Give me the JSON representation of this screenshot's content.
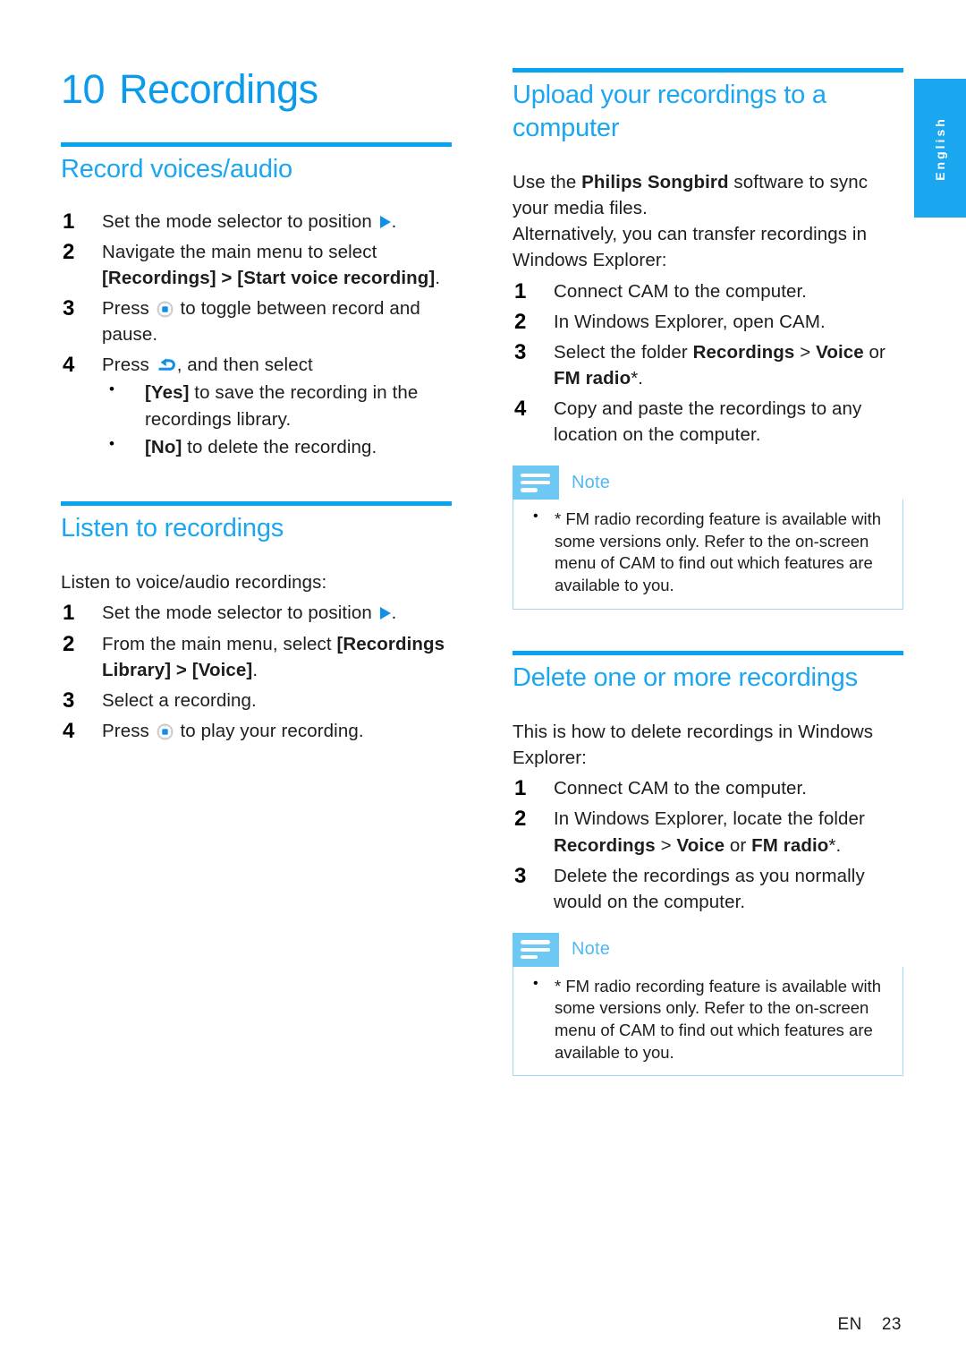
{
  "page": {
    "language_tab": "English",
    "footer_locale": "EN",
    "footer_page_number": "23",
    "accent_blue": "#0C9BEC",
    "rule_blue": "#06A3F0",
    "note_icon_blue": "#6DC8F3",
    "note_border_blue": "#9FD9F5"
  },
  "chapter": {
    "number": "10",
    "title": "Recordings"
  },
  "left_column": {
    "sections": [
      {
        "heading": "Record voices/audio",
        "steps": [
          {
            "num": "1",
            "parts": [
              {
                "type": "text",
                "value": "Set the mode selector to position "
              },
              {
                "type": "icon",
                "value": "play-triangle-icon"
              },
              {
                "type": "text",
                "value": "."
              }
            ]
          },
          {
            "num": "2",
            "parts": [
              {
                "type": "text",
                "value": "Navigate the main menu to select "
              },
              {
                "type": "bold",
                "value": "[Recordings] > [Start voice recording]"
              },
              {
                "type": "text",
                "value": "."
              }
            ]
          },
          {
            "num": "3",
            "parts": [
              {
                "type": "text",
                "value": "Press "
              },
              {
                "type": "icon",
                "value": "nav-wheel-icon"
              },
              {
                "type": "text",
                "value": " to toggle between record and pause."
              }
            ]
          },
          {
            "num": "4",
            "parts": [
              {
                "type": "text",
                "value": "Press "
              },
              {
                "type": "icon",
                "value": "back-arrow-icon"
              },
              {
                "type": "text",
                "value": ", and then select"
              }
            ],
            "subbullets": [
              {
                "parts": [
                  {
                    "type": "bold",
                    "value": "[Yes]"
                  },
                  {
                    "type": "text",
                    "value": " to save the recording in the recordings library."
                  }
                ]
              },
              {
                "parts": [
                  {
                    "type": "bold",
                    "value": "[No]"
                  },
                  {
                    "type": "text",
                    "value": " to delete the recording."
                  }
                ]
              }
            ]
          }
        ]
      },
      {
        "heading": "Listen to recordings",
        "intro": "Listen to voice/audio recordings:",
        "steps": [
          {
            "num": "1",
            "parts": [
              {
                "type": "text",
                "value": "Set the mode selector to position "
              },
              {
                "type": "icon",
                "value": "play-triangle-icon"
              },
              {
                "type": "text",
                "value": "."
              }
            ]
          },
          {
            "num": "2",
            "parts": [
              {
                "type": "text",
                "value": "From the main menu, select "
              },
              {
                "type": "bold",
                "value": "[Recordings Library] > [Voice]"
              },
              {
                "type": "text",
                "value": "."
              }
            ]
          },
          {
            "num": "3",
            "parts": [
              {
                "type": "text",
                "value": "Select a recording."
              }
            ]
          },
          {
            "num": "4",
            "parts": [
              {
                "type": "text",
                "value": "Press "
              },
              {
                "type": "icon",
                "value": "nav-wheel-icon"
              },
              {
                "type": "text",
                "value": " to play your recording."
              }
            ]
          }
        ]
      }
    ]
  },
  "right_column": {
    "sections": [
      {
        "heading": "Upload your recordings to a computer",
        "intro_paragraphs": [
          [
            {
              "type": "text",
              "value": "Use the "
            },
            {
              "type": "bold",
              "value": "Philips Songbird"
            },
            {
              "type": "text",
              "value": " software to sync your media files."
            }
          ],
          [
            {
              "type": "text",
              "value": "Alternatively, you can transfer recordings in Windows Explorer:"
            }
          ]
        ],
        "steps": [
          {
            "num": "1",
            "parts": [
              {
                "type": "text",
                "value": "Connect CAM to the computer."
              }
            ]
          },
          {
            "num": "2",
            "parts": [
              {
                "type": "text",
                "value": "In Windows Explorer, open CAM."
              }
            ]
          },
          {
            "num": "3",
            "parts": [
              {
                "type": "text",
                "value": "Select the folder "
              },
              {
                "type": "bold",
                "value": "Recordings"
              },
              {
                "type": "text",
                "value": " > "
              },
              {
                "type": "bold",
                "value": "Voice"
              },
              {
                "type": "text",
                "value": " or "
              },
              {
                "type": "bold",
                "value": "FM radio"
              },
              {
                "type": "text",
                "value": "*."
              }
            ]
          },
          {
            "num": "4",
            "parts": [
              {
                "type": "text",
                "value": "Copy and paste the recordings to any location on the computer."
              }
            ]
          }
        ],
        "note": {
          "label": "Note",
          "items": [
            "* FM radio recording feature is available with some versions only. Refer to the on-screen menu of CAM to find out which features are available to you."
          ]
        }
      },
      {
        "heading": "Delete one or more recordings",
        "intro_paragraphs": [
          [
            {
              "type": "text",
              "value": "This is how to delete recordings in Windows Explorer:"
            }
          ]
        ],
        "steps": [
          {
            "num": "1",
            "parts": [
              {
                "type": "text",
                "value": "Connect CAM to the computer."
              }
            ]
          },
          {
            "num": "2",
            "parts": [
              {
                "type": "text",
                "value": "In Windows Explorer, locate the folder "
              },
              {
                "type": "bold",
                "value": "Recordings"
              },
              {
                "type": "text",
                "value": " > "
              },
              {
                "type": "bold",
                "value": "Voice"
              },
              {
                "type": "text",
                "value": " or "
              },
              {
                "type": "bold",
                "value": "FM radio"
              },
              {
                "type": "text",
                "value": "*."
              }
            ]
          },
          {
            "num": "3",
            "parts": [
              {
                "type": "text",
                "value": "Delete the recordings as you normally would on the computer."
              }
            ]
          }
        ],
        "note": {
          "label": "Note",
          "items": [
            "* FM radio recording feature is available with some versions only. Refer to the on-screen menu of CAM to find out which features are available to you."
          ]
        }
      }
    ]
  }
}
